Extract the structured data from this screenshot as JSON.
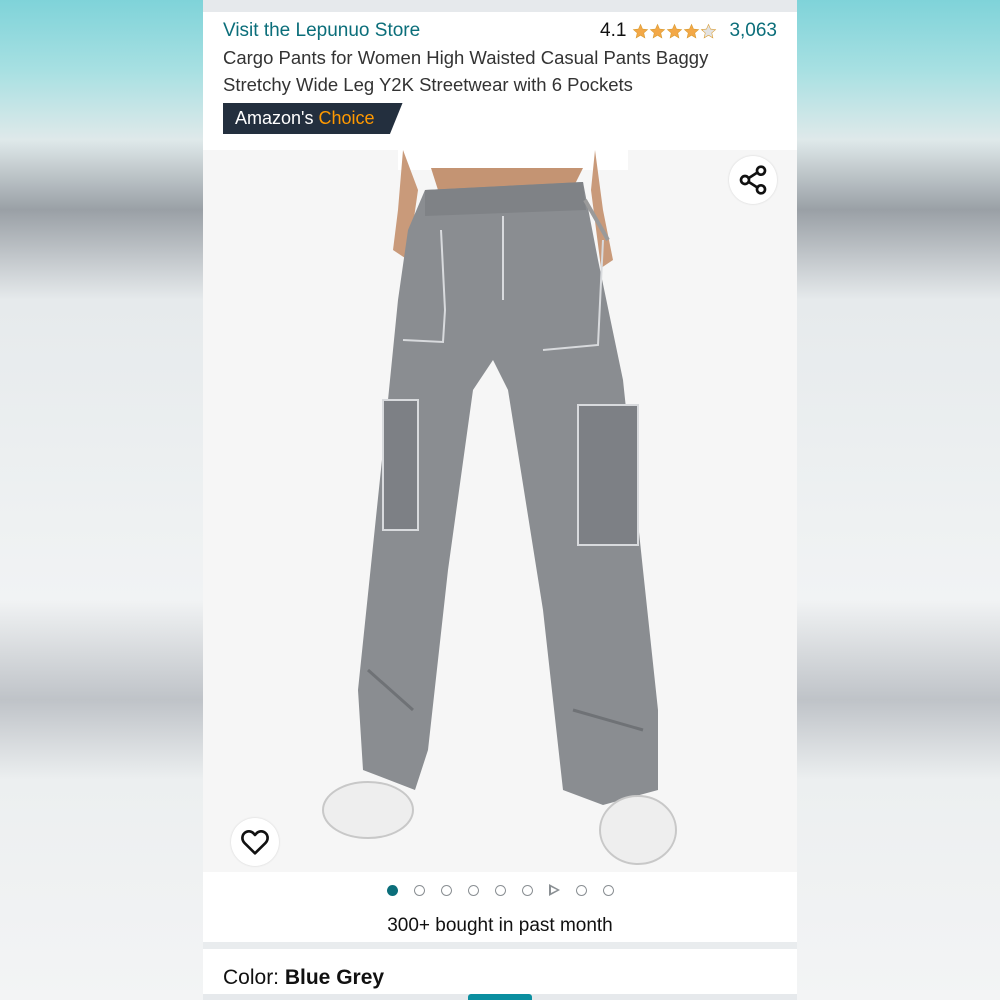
{
  "store": {
    "link_text": "Visit the Lepunuo Store"
  },
  "rating": {
    "value": "4.1",
    "stars_filled": 4.1,
    "stars_total": 5,
    "count": "3,063",
    "star_color": "#f3a847"
  },
  "product": {
    "title": "Cargo Pants for Women High Waisted Casual Pants Baggy Stretchy Wide Leg Y2K Streetwear with 6 Pockets"
  },
  "badge": {
    "prefix": "Amazon's ",
    "highlight": "Choice"
  },
  "gallery": {
    "image_alt": "Grey cargo pants with white sneakers",
    "total_dots": 9,
    "active_index": 0,
    "video_index": 6
  },
  "social_proof": {
    "text": "300+ bought in past month"
  },
  "variation": {
    "label": "Color: ",
    "value": "Blue Grey"
  },
  "colors": {
    "link": "#0b6e7a",
    "badge_bg": "#232f3e",
    "badge_accent": "#ff9900",
    "pants": "#8a8d91"
  },
  "icons": {
    "share": "share-icon",
    "heart": "heart-icon",
    "play": "play-icon"
  }
}
